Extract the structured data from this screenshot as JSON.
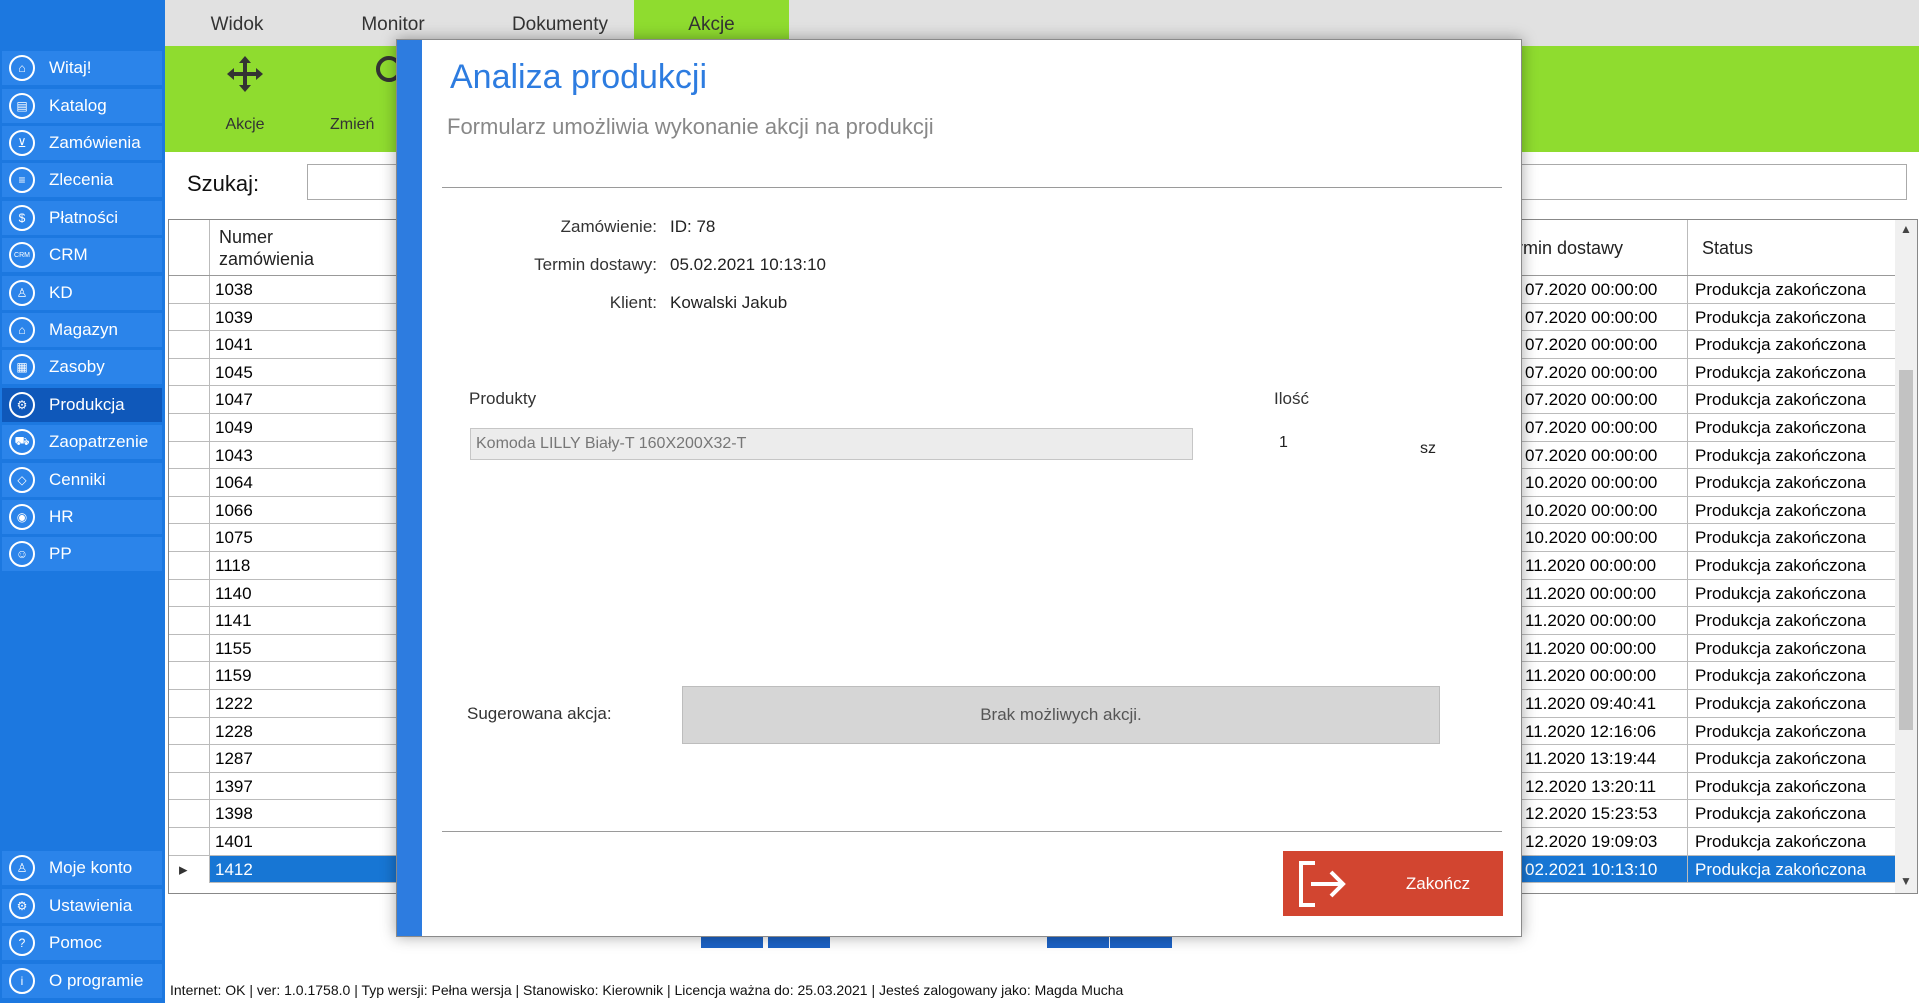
{
  "tabs": [
    "Widok",
    "Monitor",
    "Dokumenty",
    "Akcje"
  ],
  "ribbon": {
    "actions_label": "Akcje",
    "change_label": "Zmień"
  },
  "sidebar": {
    "items": [
      {
        "label": "Witaj!",
        "icon": "home-icon"
      },
      {
        "label": "Katalog",
        "icon": "book-icon"
      },
      {
        "label": "Zamówienia",
        "icon": "cart-icon"
      },
      {
        "label": "Zlecenia",
        "icon": "list-icon"
      },
      {
        "label": "Płatności",
        "icon": "dollar-icon"
      },
      {
        "label": "CRM",
        "icon": "crm-icon"
      },
      {
        "label": "KD",
        "icon": "user-icon"
      },
      {
        "label": "Magazyn",
        "icon": "warehouse-icon"
      },
      {
        "label": "Zasoby",
        "icon": "resources-icon"
      },
      {
        "label": "Produkcja",
        "icon": "production-icon"
      },
      {
        "label": "Zaopatrzenie",
        "icon": "supply-icon"
      },
      {
        "label": "Cenniki",
        "icon": "tag-icon"
      },
      {
        "label": "HR",
        "icon": "hr-icon"
      },
      {
        "label": "PP",
        "icon": "pp-icon"
      }
    ],
    "bottom": [
      {
        "label": "Moje konto",
        "icon": "account-icon"
      },
      {
        "label": "Ustawienia",
        "icon": "gear-icon"
      },
      {
        "label": "Pomoc",
        "icon": "help-icon"
      },
      {
        "label": "O programie",
        "icon": "info-icon"
      }
    ]
  },
  "search": {
    "label": "Szukaj:",
    "value": ""
  },
  "grid": {
    "headers": {
      "number": "Numer zamówienia",
      "delivery": "rmin dostawy",
      "status": "Status"
    },
    "rows": [
      {
        "number": "1038",
        "delivery": "07.2020 00:00:00",
        "status": "Produkcja zakończona"
      },
      {
        "number": "1039",
        "delivery": "07.2020 00:00:00",
        "status": "Produkcja zakończona"
      },
      {
        "number": "1041",
        "delivery": "07.2020 00:00:00",
        "status": "Produkcja zakończona"
      },
      {
        "number": "1045",
        "delivery": "07.2020 00:00:00",
        "status": "Produkcja zakończona"
      },
      {
        "number": "1047",
        "delivery": "07.2020 00:00:00",
        "status": "Produkcja zakończona"
      },
      {
        "number": "1049",
        "delivery": "07.2020 00:00:00",
        "status": "Produkcja zakończona"
      },
      {
        "number": "1043",
        "delivery": "07.2020 00:00:00",
        "status": "Produkcja zakończona"
      },
      {
        "number": "1064",
        "delivery": "10.2020 00:00:00",
        "status": "Produkcja zakończona"
      },
      {
        "number": "1066",
        "delivery": "10.2020 00:00:00",
        "status": "Produkcja zakończona"
      },
      {
        "number": "1075",
        "delivery": "10.2020 00:00:00",
        "status": "Produkcja zakończona"
      },
      {
        "number": "1118",
        "delivery": "11.2020 00:00:00",
        "status": "Produkcja zakończona"
      },
      {
        "number": "1140",
        "delivery": "11.2020 00:00:00",
        "status": "Produkcja zakończona"
      },
      {
        "number": "1141",
        "delivery": "11.2020 00:00:00",
        "status": "Produkcja zakończona"
      },
      {
        "number": "1155",
        "delivery": "11.2020 00:00:00",
        "status": "Produkcja zakończona"
      },
      {
        "number": "1159",
        "delivery": "11.2020 00:00:00",
        "status": "Produkcja zakończona"
      },
      {
        "number": "1222",
        "delivery": "11.2020 09:40:41",
        "status": "Produkcja zakończona"
      },
      {
        "number": "1228",
        "delivery": "11.2020 12:16:06",
        "status": "Produkcja zakończona"
      },
      {
        "number": "1287",
        "delivery": "11.2020 13:19:44",
        "status": "Produkcja zakończona"
      },
      {
        "number": "1397",
        "delivery": "12.2020 13:20:11",
        "status": "Produkcja zakończona"
      },
      {
        "number": "1398",
        "delivery": "12.2020 15:23:53",
        "status": "Produkcja zakończona"
      },
      {
        "number": "1401",
        "delivery": "12.2020 19:09:03",
        "status": "Produkcja zakończona"
      },
      {
        "number": "1412",
        "delivery": "02.2021 10:13:10",
        "status": "Produkcja zakończona",
        "selected": true
      }
    ]
  },
  "status_bar": "Internet: OK  |  ver: 1.0.1758.0  |  Typ wersji: Pełna wersja  |  Stanowisko: Kierownik  |  Licencja ważna do: 25.03.2021  |  Jesteś zalogowany jako: Magda Mucha",
  "modal": {
    "title": "Analiza produkcji",
    "subtitle": "Formularz umożliwia wykonanie akcji na produkcji",
    "fields": [
      {
        "label": "Zamówienie:",
        "value": "ID: 78"
      },
      {
        "label": "Termin dostawy:",
        "value": "05.02.2021 10:13:10"
      },
      {
        "label": "Klient:",
        "value": "Kowalski Jakub"
      }
    ],
    "products_label": "Produkty",
    "qty_label": "Ilość",
    "product": {
      "name": "Komoda LILLY Biały-T 160X200X32-T",
      "qty": "1",
      "unit": "sz"
    },
    "suggested_label": "Sugerowana akcja:",
    "suggested_value": "Brak możliwych akcji.",
    "finish_label": "Zakończ"
  },
  "colors": {
    "sidebar": "#1c78e0",
    "ribbon": "#8fdc2f",
    "accent": "#2d7ce0",
    "finish": "#d24530",
    "selected_row": "#1776d4"
  }
}
